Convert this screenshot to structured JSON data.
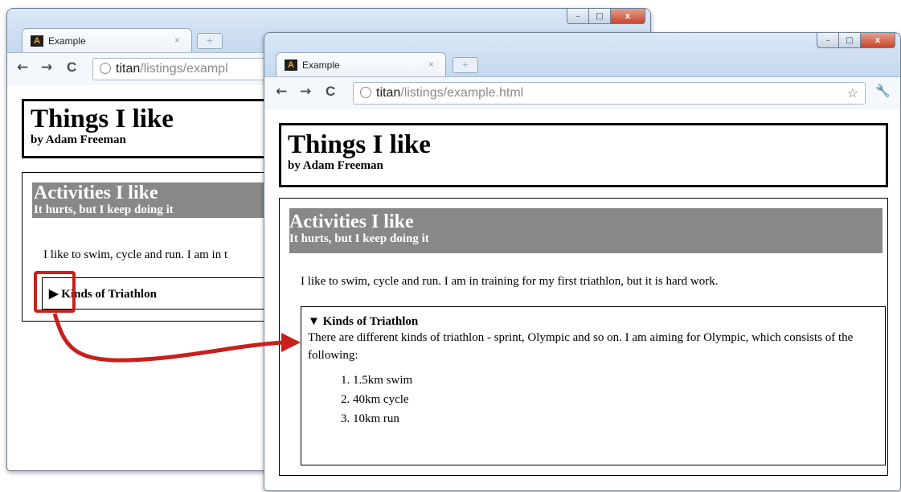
{
  "back_window": {
    "tab": {
      "title": "Example",
      "close": "×",
      "favicon": "A"
    },
    "url": {
      "host": "titan",
      "path": "/listings/exampl"
    },
    "page": {
      "title": "Things I like",
      "byline": "by Adam Freeman",
      "section_title": "Activities I like",
      "section_subtitle": "It hurts, but I keep doing it",
      "paragraph": "I like to swim, cycle and run. I am in t",
      "summary_marker": "▶",
      "summary": "Kinds of Triathlon"
    }
  },
  "front_window": {
    "tab": {
      "title": "Example",
      "close": "×",
      "favicon": "A"
    },
    "url": {
      "host": "titan",
      "path": "/listings/example.html"
    },
    "page": {
      "title": "Things I like",
      "byline": "by Adam Freeman",
      "section_title": "Activities I like",
      "section_subtitle": "It hurts, but I keep doing it",
      "paragraph": "I like to swim, cycle and run. I am in training for my first triathlon, but it is hard work.",
      "summary_marker": "▼",
      "summary": "Kinds of Triathlon",
      "details_text": "There are different kinds of triathlon - sprint, Olympic and so on. I am aiming for Olympic, which consists of the following:",
      "list": [
        "1.5km swim",
        "40km cycle",
        "10km run"
      ]
    }
  },
  "colors": {
    "highlight": "#c8201c",
    "section_header_bg": "#888888",
    "window_frame": "#cfe0f3"
  },
  "icons": {
    "back": "←",
    "forward": "→",
    "reload": "C",
    "star": "☆",
    "wrench": "🔧",
    "new_tab": "+",
    "minimize": "–",
    "maximize": "□",
    "close": "x"
  }
}
